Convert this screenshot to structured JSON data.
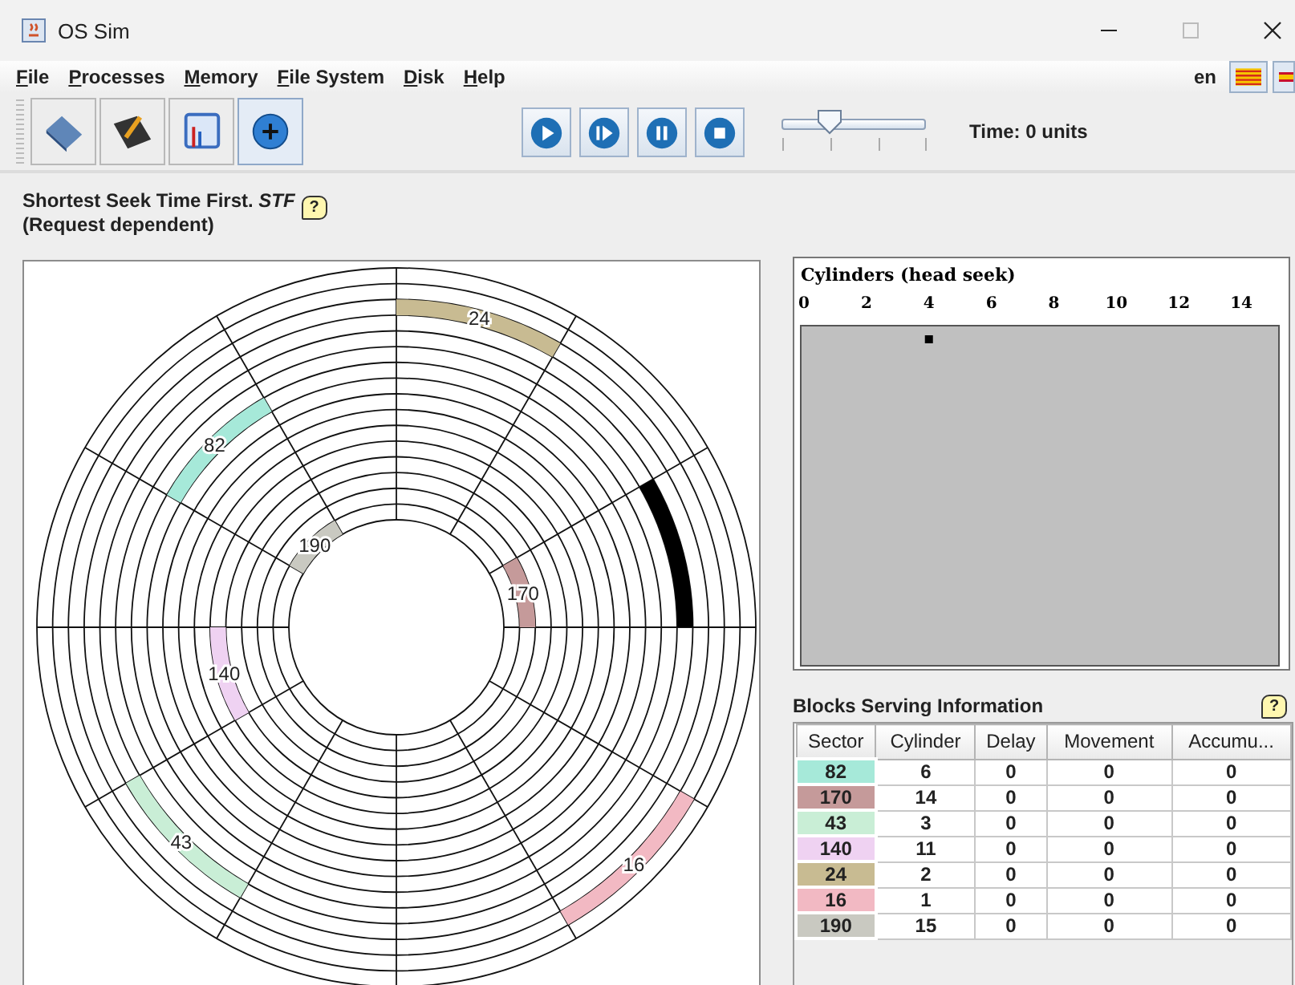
{
  "window": {
    "title": "OS Sim"
  },
  "menu": [
    "File",
    "Processes",
    "Memory",
    "File System",
    "Disk",
    "Help"
  ],
  "language": {
    "code": "en"
  },
  "toolbar": {
    "slider": {
      "level": 0.34
    },
    "time": "Time: 0 units"
  },
  "algorithm": {
    "title": "Shortest Seek Time First. ",
    "abbr": "STF",
    "subtitle": "(Request dependent)",
    "help": "?"
  },
  "disk": {
    "blocks": [
      {
        "label": "24",
        "color": "#c8bb92"
      },
      {
        "label": "82",
        "color": "#a6e9d9"
      },
      {
        "label": "190",
        "color": "#c9c9c1"
      },
      {
        "label": "170",
        "color": "#c59a9a"
      },
      {
        "label": "140",
        "color": "#efd2f2"
      },
      {
        "label": "43",
        "color": "#c9eed6"
      },
      {
        "label": "16",
        "color": "#f2b9c3"
      }
    ]
  },
  "head_seek": {
    "title": "Cylinders (head seek)",
    "ticks": [
      "0",
      "2",
      "4",
      "6",
      "8",
      "10",
      "12",
      "14"
    ]
  },
  "blocks_info": {
    "title": "Blocks Serving Information",
    "help": "?",
    "columns": [
      "Sector",
      "Cylinder",
      "Delay",
      "Movement",
      "Accumu..."
    ],
    "rows": [
      {
        "cells": [
          "82",
          "6",
          "0",
          "0",
          "0"
        ],
        "color": "#a6e9d9"
      },
      {
        "cells": [
          "170",
          "14",
          "0",
          "0",
          "0"
        ],
        "color": "#c59a9a"
      },
      {
        "cells": [
          "43",
          "3",
          "0",
          "0",
          "0"
        ],
        "color": "#c9eed6"
      },
      {
        "cells": [
          "140",
          "11",
          "0",
          "0",
          "0"
        ],
        "color": "#efd2f2"
      },
      {
        "cells": [
          "24",
          "2",
          "0",
          "0",
          "0"
        ],
        "color": "#c8bb92"
      },
      {
        "cells": [
          "16",
          "1",
          "0",
          "0",
          "0"
        ],
        "color": "#f2b9c3"
      },
      {
        "cells": [
          "190",
          "15",
          "0",
          "0",
          "0"
        ],
        "color": "#c9c9c1"
      }
    ]
  }
}
